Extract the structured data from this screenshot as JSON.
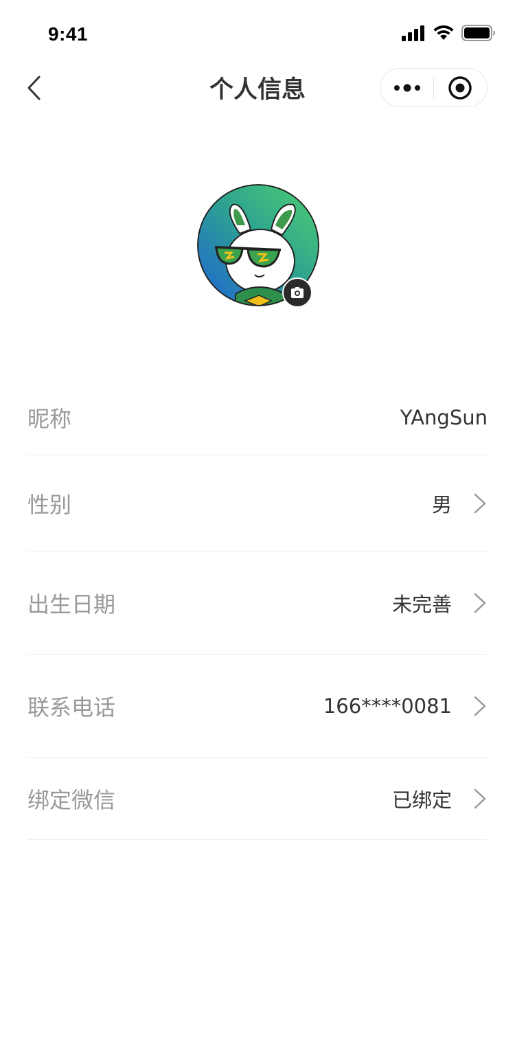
{
  "status_bar": {
    "time": "9:41"
  },
  "nav": {
    "title": "个人信息",
    "back_icon": "chevron-left-icon",
    "more_icon": "more-dots-icon",
    "close_icon": "target-circle-icon"
  },
  "avatar": {
    "camera_icon": "camera-icon",
    "colors": {
      "gradient_start": "#1e62d6",
      "gradient_end": "#4fcf70"
    }
  },
  "fields": [
    {
      "label": "昵称",
      "value": "YAngSun"
    },
    {
      "label": "性别",
      "value": "男"
    },
    {
      "label": "出生日期",
      "value": "未完善"
    },
    {
      "label": "联系电话",
      "value": "166****0081"
    },
    {
      "label": "绑定微信",
      "value": "已绑定"
    }
  ],
  "colors": {
    "label": "#999999",
    "value": "#333333",
    "divider": "#eeeeee",
    "chevron": "#999999"
  }
}
